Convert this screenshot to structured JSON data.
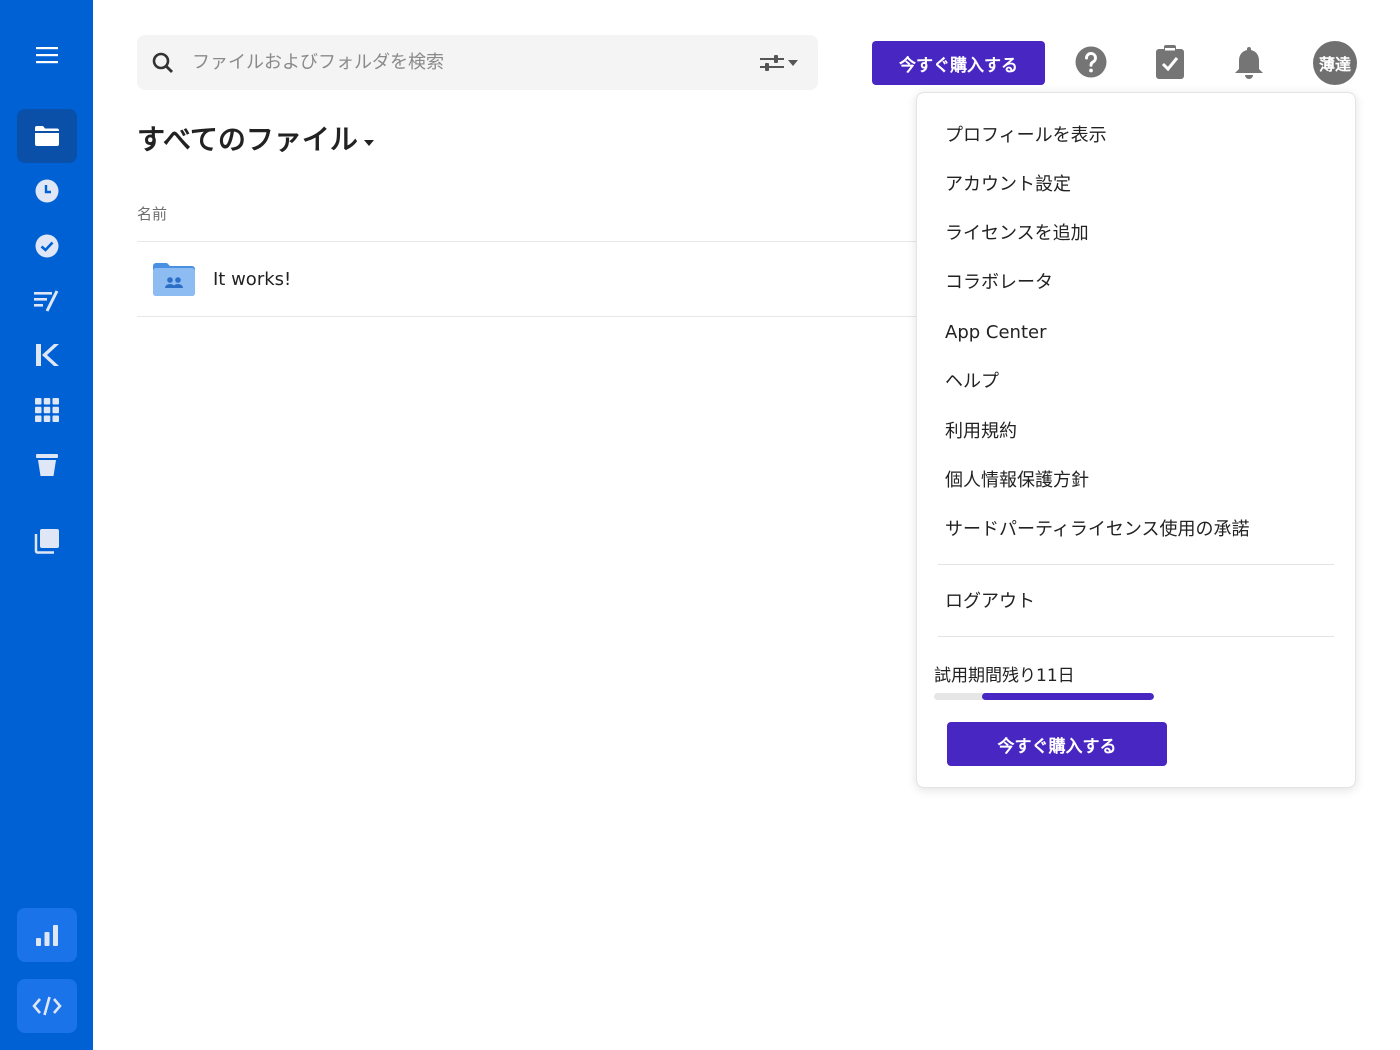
{
  "search": {
    "placeholder": "ファイルおよびフォルダを検索",
    "value": ""
  },
  "header": {
    "buy_label": "今すぐ購入する",
    "avatar_text": "薄達"
  },
  "main": {
    "title": "すべてのファイル",
    "column_name": "名前",
    "files": [
      {
        "name": "It works!",
        "type": "collaborated-folder"
      }
    ]
  },
  "account_menu": {
    "items": [
      "プロフィールを表示",
      "アカウント設定",
      "ライセンスを追加",
      "コラボレータ",
      "App Center",
      "ヘルプ",
      "利用規約",
      "個人情報保護方針",
      "サードパーティライセンス使用の承諾"
    ],
    "logout_label": "ログアウト",
    "trial_text": "試用期間残り11日",
    "trial_progress": 0.78,
    "buy_label": "今すぐ購入する"
  },
  "sidebar": {
    "items": [
      {
        "icon": "hamburger-menu-icon"
      },
      {
        "icon": "all-files-folder-icon",
        "active": true
      },
      {
        "icon": "recents-clock-icon"
      },
      {
        "icon": "tasks-check-icon"
      },
      {
        "icon": "notes-icon"
      },
      {
        "icon": "relay-workflow-icon"
      },
      {
        "icon": "apps-grid-icon"
      },
      {
        "icon": "trash-icon"
      },
      {
        "icon": "collections-icon"
      },
      {
        "icon": "analytics-chart-icon"
      },
      {
        "icon": "dev-console-code-icon"
      }
    ]
  },
  "colors": {
    "sidebar": "#0061d5",
    "sidebar_active": "#0a4fa8",
    "brand_purple": "#4826c2",
    "folder_blue": "#4a90e2"
  }
}
